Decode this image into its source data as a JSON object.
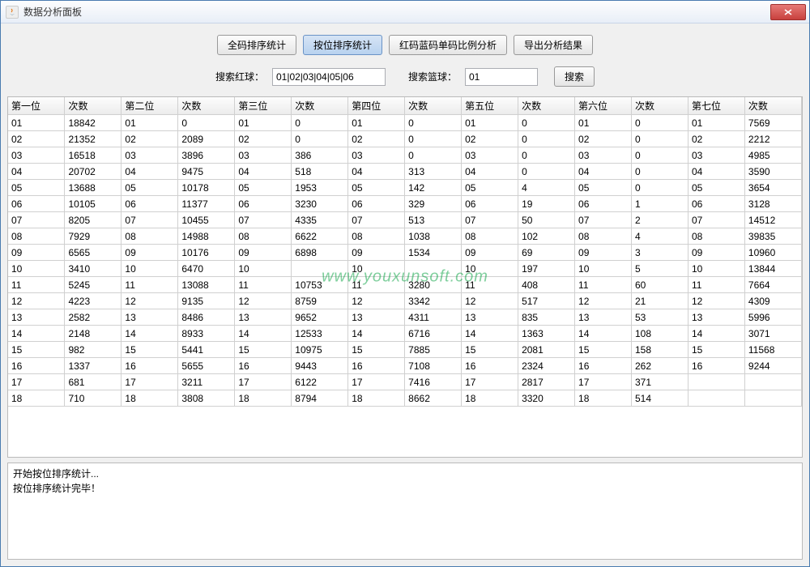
{
  "window": {
    "title": "数据分析面板"
  },
  "toolbar": {
    "all_code_stat": "全码排序统计",
    "by_position_stat": "按位排序统计",
    "ratio_analysis": "红码蓝码单码比例分析",
    "export_result": "导出分析结果"
  },
  "search": {
    "red_label": "搜索红球：",
    "red_value": "01|02|03|04|05|06",
    "blue_label": "搜索篮球：",
    "blue_value": "01",
    "search_btn": "搜索"
  },
  "table": {
    "headers": [
      "第一位",
      "次数",
      "第二位",
      "次数",
      "第三位",
      "次数",
      "第四位",
      "次数",
      "第五位",
      "次数",
      "第六位",
      "次数",
      "第七位",
      "次数"
    ],
    "rows": [
      [
        "01",
        "18842",
        "01",
        "0",
        "01",
        "0",
        "01",
        "0",
        "01",
        "0",
        "01",
        "0",
        "01",
        "7569"
      ],
      [
        "02",
        "21352",
        "02",
        "2089",
        "02",
        "0",
        "02",
        "0",
        "02",
        "0",
        "02",
        "0",
        "02",
        "2212"
      ],
      [
        "03",
        "16518",
        "03",
        "3896",
        "03",
        "386",
        "03",
        "0",
        "03",
        "0",
        "03",
        "0",
        "03",
        "4985"
      ],
      [
        "04",
        "20702",
        "04",
        "9475",
        "04",
        "518",
        "04",
        "313",
        "04",
        "0",
        "04",
        "0",
        "04",
        "3590"
      ],
      [
        "05",
        "13688",
        "05",
        "10178",
        "05",
        "1953",
        "05",
        "142",
        "05",
        "4",
        "05",
        "0",
        "05",
        "3654"
      ],
      [
        "06",
        "10105",
        "06",
        "11377",
        "06",
        "3230",
        "06",
        "329",
        "06",
        "19",
        "06",
        "1",
        "06",
        "3128"
      ],
      [
        "07",
        "8205",
        "07",
        "10455",
        "07",
        "4335",
        "07",
        "513",
        "07",
        "50",
        "07",
        "2",
        "07",
        "14512"
      ],
      [
        "08",
        "7929",
        "08",
        "14988",
        "08",
        "6622",
        "08",
        "1038",
        "08",
        "102",
        "08",
        "4",
        "08",
        "39835"
      ],
      [
        "09",
        "6565",
        "09",
        "10176",
        "09",
        "6898",
        "09",
        "1534",
        "09",
        "69",
        "09",
        "3",
        "09",
        "10960"
      ],
      [
        "10",
        "3410",
        "10",
        "6470",
        "10",
        "",
        "10",
        "",
        "10",
        "197",
        "10",
        "5",
        "10",
        "13844"
      ],
      [
        "11",
        "5245",
        "11",
        "13088",
        "11",
        "10753",
        "11",
        "3280",
        "11",
        "408",
        "11",
        "60",
        "11",
        "7664"
      ],
      [
        "12",
        "4223",
        "12",
        "9135",
        "12",
        "8759",
        "12",
        "3342",
        "12",
        "517",
        "12",
        "21",
        "12",
        "4309"
      ],
      [
        "13",
        "2582",
        "13",
        "8486",
        "13",
        "9652",
        "13",
        "4311",
        "13",
        "835",
        "13",
        "53",
        "13",
        "5996"
      ],
      [
        "14",
        "2148",
        "14",
        "8933",
        "14",
        "12533",
        "14",
        "6716",
        "14",
        "1363",
        "14",
        "108",
        "14",
        "3071"
      ],
      [
        "15",
        "982",
        "15",
        "5441",
        "15",
        "10975",
        "15",
        "7885",
        "15",
        "2081",
        "15",
        "158",
        "15",
        "11568"
      ],
      [
        "16",
        "1337",
        "16",
        "5655",
        "16",
        "9443",
        "16",
        "7108",
        "16",
        "2324",
        "16",
        "262",
        "16",
        "9244"
      ],
      [
        "17",
        "681",
        "17",
        "3211",
        "17",
        "6122",
        "17",
        "7416",
        "17",
        "2817",
        "17",
        "371",
        "",
        ""
      ],
      [
        "18",
        "710",
        "18",
        "3808",
        "18",
        "8794",
        "18",
        "8662",
        "18",
        "3320",
        "18",
        "514",
        "",
        ""
      ]
    ]
  },
  "log": {
    "line1": "开始按位排序统计...",
    "line2": "按位排序统计完毕！"
  },
  "watermark": "www.youxunsoft.com"
}
